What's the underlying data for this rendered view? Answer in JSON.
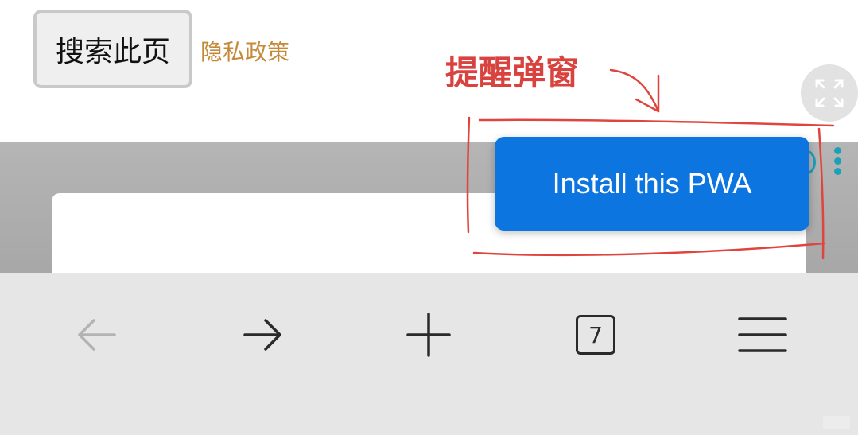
{
  "top": {
    "search_button_label": "搜索此页",
    "privacy_link": "隐私政策",
    "expand_icon": "expand-arrows-icon"
  },
  "annotation": {
    "label": "提醒弹窗",
    "color": "#d9433f"
  },
  "popup": {
    "install_label": "Install this PWA",
    "color": "#0d75e0"
  },
  "toolbar": {
    "back_icon": "arrow-left-icon",
    "forward_icon": "arrow-right-icon",
    "new_tab_icon": "plus-icon",
    "tab_count": "7",
    "menu_icon": "hamburger-menu-icon"
  }
}
